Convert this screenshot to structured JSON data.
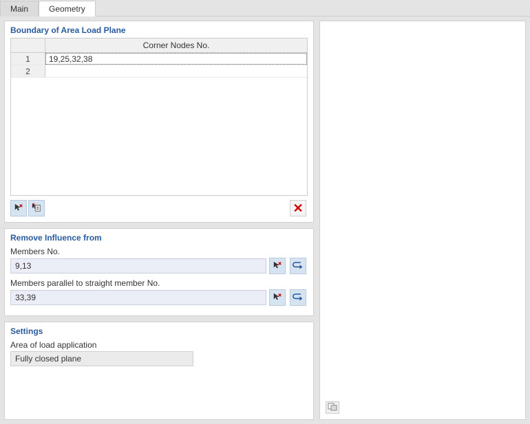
{
  "tabs": {
    "main": "Main",
    "geometry": "Geometry",
    "active": "geometry"
  },
  "boundary": {
    "title": "Boundary of Area Load Plane",
    "column_header": "Corner Nodes No.",
    "rows": [
      {
        "n": "1",
        "value": "19,25,32,38"
      },
      {
        "n": "2",
        "value": ""
      }
    ]
  },
  "remove": {
    "title": "Remove Influence from",
    "members_label": "Members No.",
    "members_value": "9,13",
    "parallel_label": "Members parallel to straight member No.",
    "parallel_value": "33,39"
  },
  "settings": {
    "title": "Settings",
    "area_label": "Area of load application",
    "area_value": "Fully closed plane"
  }
}
